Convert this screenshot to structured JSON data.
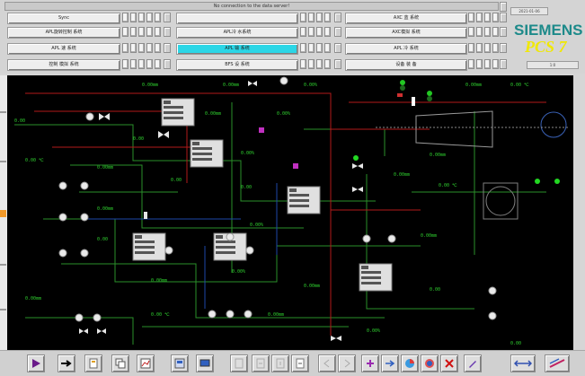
{
  "header": {
    "message": "No connection to the data server!",
    "brand_name": "SIEMENS",
    "brand_product": "PCS 7",
    "rows": [
      [
        "Sync",
        "",
        "AXC 蓝 系统"
      ],
      [
        "APL旋转控制 系统",
        "APL冷 水系统",
        "AXC模拟 系统"
      ],
      [
        "APL 速 系统",
        "APL 输 系统",
        "APL 冷 系统"
      ],
      [
        "控制 模拟 系统",
        "BFS 设 系统",
        "设备 装 备"
      ]
    ],
    "active_button": "APL 输 系统",
    "small_fields": [
      "2021-01-06",
      "1:0"
    ]
  },
  "process": {
    "tag_values": [
      "0.00mm",
      "0.00mm",
      "0.00%",
      "0.00mm",
      "0.00 ℃",
      "0.00",
      "0.00mm",
      "0.00%",
      "0.00",
      "0.00mm",
      "0.00%",
      "0.00 ℃",
      "0.00mm",
      "0.00",
      "0.00",
      "0.00mm",
      "0.00 ℃",
      "0.00mm",
      "0.00%",
      "0.00mm",
      "0.00",
      "0.00mm",
      "0.00%",
      "0.00mm",
      "0.00",
      "0.00 ℃",
      "0.00mm",
      "0.00%",
      "0.00mm",
      "0.00"
    ]
  },
  "toolbar": {
    "icons": [
      "play-icon",
      "arrow-right-icon",
      "report-icon",
      "copy-icon",
      "trend-icon",
      "layout-icon",
      "screen-icon",
      "page-icon",
      "nav-back-icon",
      "nav-up-icon",
      "nav-down-icon",
      "nav-forward-icon",
      "window-left-icon",
      "window-right-icon",
      "mark-icon",
      "arrow-right-small-icon",
      "arrow-blue-icon",
      "chart-circle-icon",
      "globe-icon",
      "close-red-icon",
      "palette-icon",
      "info-icon",
      "settings-tool-icon",
      "pencil-icon"
    ]
  }
}
